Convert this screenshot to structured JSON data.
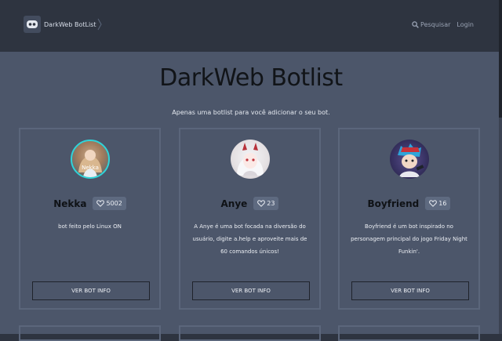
{
  "navbar": {
    "brand": "DarkWeb BotList",
    "search_label": "Pesquisar",
    "login_label": "Login"
  },
  "hero": {
    "title": "DarkWeb Botlist",
    "subtitle": "Apenas uma botlist para você adicionar o seu bot."
  },
  "bots": [
    {
      "name": "Nekka",
      "votes": "5002",
      "avatar_caption": "Nekka",
      "description": "bot feito pelo Linux ON",
      "button_label": "VER BOT INFO"
    },
    {
      "name": "Anye",
      "votes": "23",
      "description": "A Anye é uma bot focada na diversão do usuário, digite a.help e aproveite mais de 60 comandos únicos!",
      "button_label": "VER BOT INFO"
    },
    {
      "name": "Boyfriend",
      "votes": "16",
      "description": "Boyfriend é um bot inspirado no personagem principal do jogo Friday Night Funkin'.",
      "button_label": "VER BOT INFO"
    }
  ],
  "colors": {
    "background_dark": "#2e3440",
    "background_main": "#4c566a",
    "card_border": "#5b667b",
    "avatar_ring_cyan": "#2fd4d9"
  },
  "icons": {
    "logo": "robot-face-icon",
    "search": "search-icon",
    "heart": "heart-icon"
  }
}
